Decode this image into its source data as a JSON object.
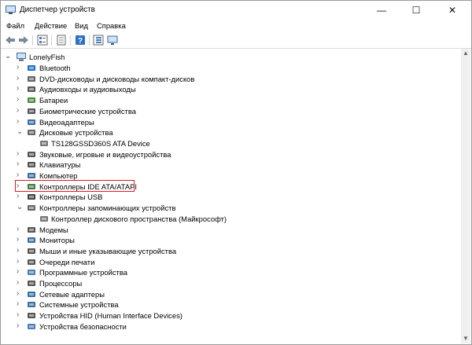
{
  "window": {
    "title": "Диспетчер устройств",
    "minimize": "—",
    "maximize": "☐",
    "close": "✕"
  },
  "menu": [
    "Файл",
    "Действие",
    "Вид",
    "Справка"
  ],
  "toolbar": [
    "back-icon",
    "forward-icon",
    "tree-view-icon",
    "properties-icon",
    "help-icon",
    "tree-icon",
    "monitor-icon"
  ],
  "tree": {
    "root": "LonelyFish",
    "items": [
      {
        "label": "Bluetooth",
        "icon": "bluetooth-icon",
        "state": "collapsed"
      },
      {
        "label": "DVD-дисководы и дисководы компакт-дисков",
        "icon": "dvd-icon",
        "state": "collapsed"
      },
      {
        "label": "Аудиовходы и аудиовыходы",
        "icon": "audio-icon",
        "state": "collapsed"
      },
      {
        "label": "Батареи",
        "icon": "battery-icon",
        "state": "collapsed"
      },
      {
        "label": "Биометрические устройства",
        "icon": "fingerprint-icon",
        "state": "collapsed"
      },
      {
        "label": "Видеоадаптеры",
        "icon": "display-adapter-icon",
        "state": "collapsed"
      },
      {
        "label": "Дисковые устройства",
        "icon": "disk-drive-icon",
        "state": "expanded"
      },
      {
        "label": "TS128GSSD360S ATA Device",
        "icon": "disk-icon",
        "state": "child"
      },
      {
        "label": "Звуковые, игровые и видеоустройства",
        "icon": "speaker-icon",
        "state": "collapsed"
      },
      {
        "label": "Клавиатуры",
        "icon": "keyboard-icon",
        "state": "collapsed"
      },
      {
        "label": "Компьютер",
        "icon": "computer-icon",
        "state": "collapsed"
      },
      {
        "label": "Контроллеры IDE ATA/ATAPI",
        "icon": "ide-controller-icon",
        "state": "collapsed",
        "highlighted": true
      },
      {
        "label": "Контроллеры USB",
        "icon": "usb-icon",
        "state": "collapsed"
      },
      {
        "label": "Контроллеры запоминающих устройств",
        "icon": "storage-controller-icon",
        "state": "expanded"
      },
      {
        "label": "Контроллер дискового пространства (Майкрософт)",
        "icon": "storage-icon",
        "state": "child"
      },
      {
        "label": "Модемы",
        "icon": "modem-icon",
        "state": "collapsed"
      },
      {
        "label": "Мониторы",
        "icon": "monitor-icon",
        "state": "collapsed"
      },
      {
        "label": "Мыши и иные указывающие устройства",
        "icon": "mouse-icon",
        "state": "collapsed"
      },
      {
        "label": "Очереди печати",
        "icon": "printer-icon",
        "state": "collapsed"
      },
      {
        "label": "Программные устройства",
        "icon": "software-device-icon",
        "state": "collapsed"
      },
      {
        "label": "Процессоры",
        "icon": "processor-icon",
        "state": "collapsed"
      },
      {
        "label": "Сетевые адаптеры",
        "icon": "network-adapter-icon",
        "state": "collapsed"
      },
      {
        "label": "Системные устройства",
        "icon": "system-device-icon",
        "state": "collapsed"
      },
      {
        "label": "Устройства HID (Human Interface Devices)",
        "icon": "hid-icon",
        "state": "collapsed"
      },
      {
        "label": "Устройства безопасности",
        "icon": "security-device-icon",
        "state": "collapsed"
      }
    ]
  },
  "colors": {
    "highlight_border": "#d41f25",
    "accent": "#1e6fc2"
  }
}
